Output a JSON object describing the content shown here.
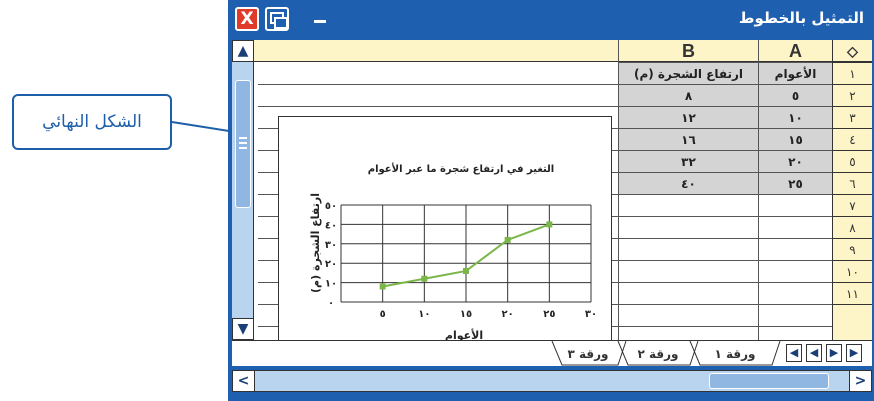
{
  "callout": {
    "text": "الشكل النهائي"
  },
  "window": {
    "title": "التمثيل بالخطوط",
    "close_glyph": "X",
    "minimize_glyph": "_"
  },
  "sheet": {
    "corner_glyph": "◇",
    "columns": [
      "A",
      "B"
    ],
    "header_row": {
      "A": "الأعوام",
      "B": "ارتفاع الشجرة (م)"
    },
    "row_numbers": [
      "١",
      "٢",
      "٣",
      "٤",
      "٥",
      "٦",
      "٧",
      "٨",
      "٩",
      "١٠",
      "١١"
    ],
    "rows": [
      {
        "A": "٥",
        "B": "٨"
      },
      {
        "A": "١٠",
        "B": "١٢"
      },
      {
        "A": "١٥",
        "B": "١٦"
      },
      {
        "A": "٢٠",
        "B": "٣٢"
      },
      {
        "A": "٢٥",
        "B": "٤٠"
      }
    ],
    "scroll_up": "▲",
    "scroll_down": "▼"
  },
  "chart_data": {
    "type": "line",
    "title": "التغير في ارتفاع شجرة ما عبر الأعوام",
    "xlabel": "الأعوام",
    "ylabel": "ارتفاع الشجرة (م)",
    "x_ticks": [
      "٥",
      "١٠",
      "١٥",
      "٢٠",
      "٢٥",
      "٣٠"
    ],
    "y_ticks": [
      "٠",
      "١٠",
      "٢٠",
      "٣٠",
      "٤٠",
      "٥٠"
    ],
    "x": [
      5,
      10,
      15,
      20,
      25
    ],
    "y": [
      8,
      12,
      16,
      32,
      40
    ],
    "xlim": [
      0,
      30
    ],
    "ylim": [
      0,
      50
    ],
    "grid": true,
    "color": "#7ab648"
  },
  "tabs": [
    {
      "label": "ورقة ١",
      "active": true
    },
    {
      "label": "ورقة ٢",
      "active": false
    },
    {
      "label": "ورقة ٣",
      "active": false
    }
  ],
  "tab_nav": [
    "◀",
    "◀",
    "▶",
    "▶"
  ],
  "hscroll": {
    "left": "<",
    "right": ">"
  },
  "colors": {
    "titlebar": "#1f5fb0",
    "header": "#fdf5c8",
    "shaded": "#d4d4d4",
    "scrollbar": "#b9d4ee",
    "callout": "#1d5fa8"
  }
}
